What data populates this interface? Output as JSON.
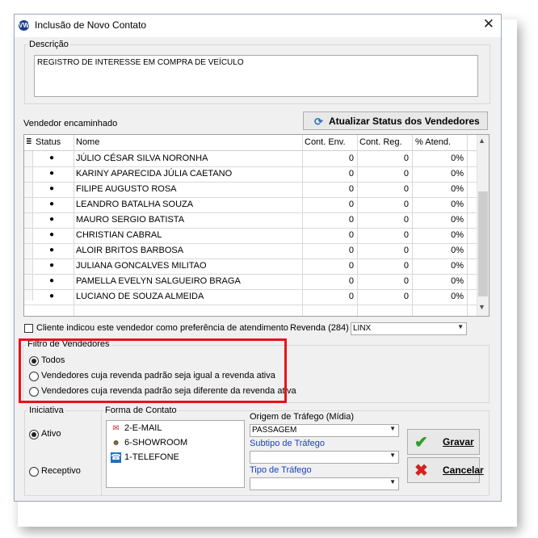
{
  "window": {
    "title": "Inclusão de Novo Contato",
    "close_glyph": "✕"
  },
  "descricao": {
    "label": "Descrição",
    "value": "REGISTRO DE INTERESSE EM COMPRA DE VEÍCULO"
  },
  "vendedor": {
    "label": "Vendedor encaminhado",
    "update_button": "Atualizar Status dos Vendedores"
  },
  "table": {
    "columns": [
      "Status",
      "Nome",
      "Cont. Env.",
      "Cont. Reg.",
      "% Atend."
    ],
    "rows": [
      {
        "status": "●",
        "nome": "JÚLIO CÉSAR SILVA NORONHA",
        "env": "0",
        "reg": "0",
        "atend": "0%"
      },
      {
        "status": "●",
        "nome": "KARINY APARECIDA JÚLIA CAETANO",
        "env": "0",
        "reg": "0",
        "atend": "0%"
      },
      {
        "status": "●",
        "nome": "FILIPE AUGUSTO ROSA",
        "env": "0",
        "reg": "0",
        "atend": "0%"
      },
      {
        "status": "●",
        "nome": "LEANDRO BATALHA SOUZA",
        "env": "0",
        "reg": "0",
        "atend": "0%"
      },
      {
        "status": "●",
        "nome": "MAURO SERGIO BATISTA",
        "env": "0",
        "reg": "0",
        "atend": "0%"
      },
      {
        "status": "●",
        "nome": "CHRISTIAN CABRAL",
        "env": "0",
        "reg": "0",
        "atend": "0%"
      },
      {
        "status": "●",
        "nome": "ALOIR BRITOS BARBOSA",
        "env": "0",
        "reg": "0",
        "atend": "0%"
      },
      {
        "status": "●",
        "nome": "JULIANA GONCALVES MILITAO",
        "env": "0",
        "reg": "0",
        "atend": "0%"
      },
      {
        "status": "●",
        "nome": "PAMELLA EVELYN SALGUEIRO BRAGA",
        "env": "0",
        "reg": "0",
        "atend": "0%"
      },
      {
        "status": "●",
        "nome": "LUCIANO DE SOUZA ALMEIDA",
        "env": "0",
        "reg": "0",
        "atend": "0%"
      }
    ]
  },
  "preferencia": {
    "label": "Cliente indicou este vendedor como preferência de atendimento",
    "checked": false
  },
  "revenda": {
    "label": "Revenda (284)",
    "value": "LINX"
  },
  "filtro": {
    "label": "Filtro de Vendedores",
    "options": [
      {
        "label": "Todos",
        "selected": true
      },
      {
        "label": "Vendedores cuja revenda padrão seja igual a revenda ativa",
        "selected": false
      },
      {
        "label": "Vendedores cuja revenda padrão seja diferente da revenda ativa",
        "selected": false
      }
    ],
    "highlight_color": "#e3151a"
  },
  "iniciativa": {
    "label": "Iniciativa",
    "options": [
      {
        "label": "Ativo",
        "selected": true
      },
      {
        "label": "Receptivo",
        "selected": false
      }
    ]
  },
  "forma": {
    "label": "Forma de Contato",
    "items": [
      {
        "label": "2-E-MAIL",
        "icon": "email-icon"
      },
      {
        "label": "6-SHOWROOM",
        "icon": "person-icon"
      },
      {
        "label": "1-TELEFONE",
        "icon": "phone-icon"
      }
    ]
  },
  "origem": {
    "label": "Origem de Tráfego (Mídia)",
    "value": "PASSAGEM"
  },
  "subtipo": {
    "label": "Subtipo de Tráfego",
    "value": ""
  },
  "tipo": {
    "label": "Tipo de Tráfego",
    "value": ""
  },
  "actions": {
    "save": "Gravar",
    "cancel": "Cancelar"
  }
}
